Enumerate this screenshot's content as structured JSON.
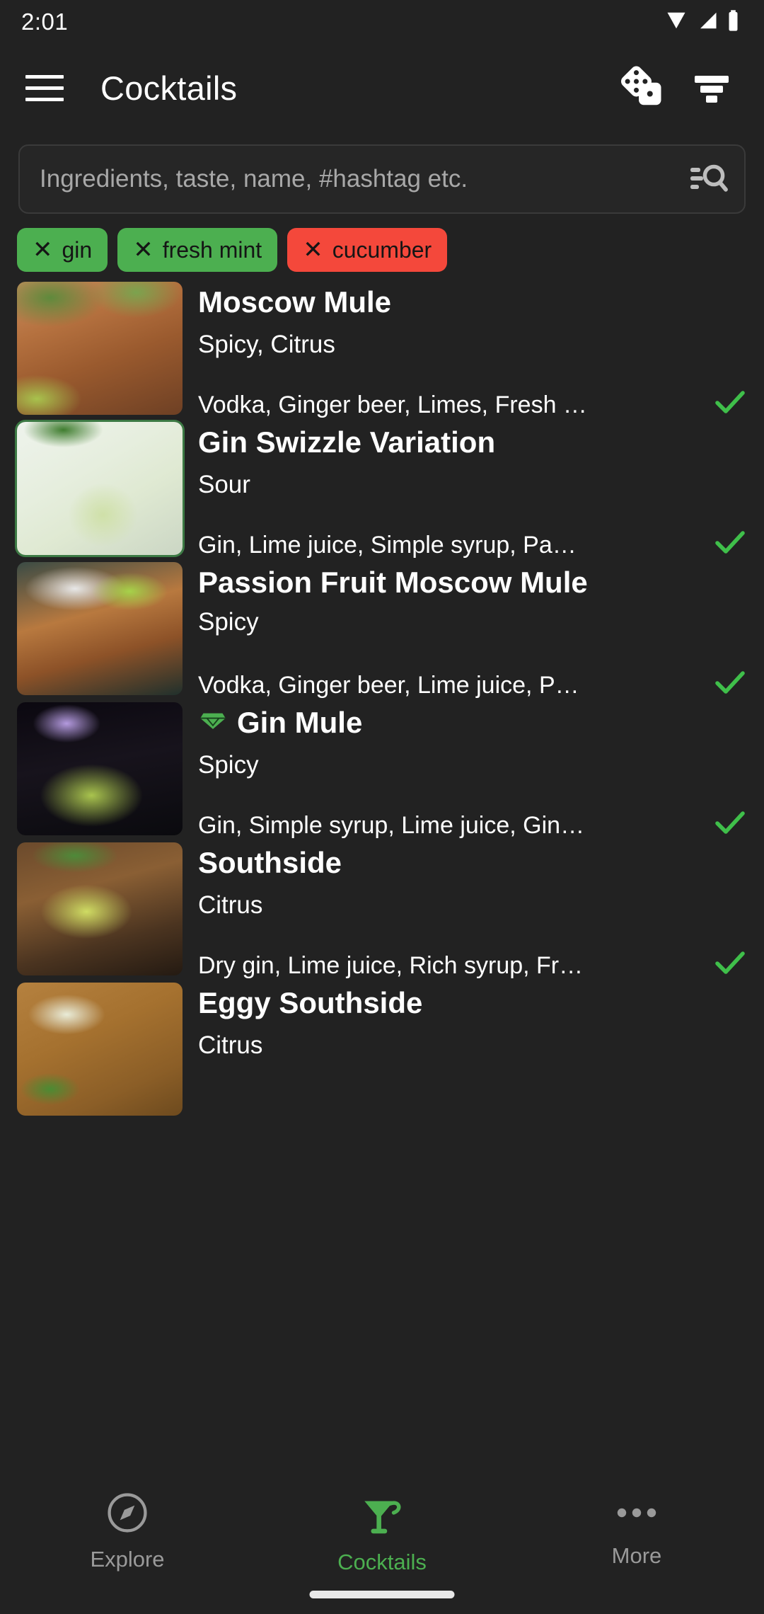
{
  "status_bar": {
    "time": "2:01",
    "icons": [
      "wifi-icon",
      "cellular-signal-icon",
      "battery-icon"
    ]
  },
  "app_bar": {
    "menu_icon": "hamburger-menu-icon",
    "title": "Cocktails",
    "random_icon": "dice-icon",
    "filter_icon": "filter-icon"
  },
  "search": {
    "placeholder": "Ingredients, taste, name, #hashtag etc.",
    "value": "",
    "icon": "search-with-lines-icon"
  },
  "filter_chips": [
    {
      "label": "gin",
      "color": "#4CAF50",
      "state": "include",
      "remove_icon": "close-x-icon"
    },
    {
      "label": "fresh mint",
      "color": "#4CAF50",
      "state": "include",
      "remove_icon": "close-x-icon"
    },
    {
      "label": "cucumber",
      "color": "#F4483B",
      "state": "exclude",
      "remove_icon": "close-x-icon"
    }
  ],
  "cocktails": [
    {
      "name": "Moscow Mule",
      "taste": "Spicy, Citrus",
      "ingredients": "Vodka, Ginger beer, Limes, Fresh …",
      "has_check": true,
      "premium": false,
      "highlight_ring": false
    },
    {
      "name": "Gin Swizzle Variation",
      "taste": "Sour",
      "ingredients": "Gin, Lime juice, Simple syrup, Pa…",
      "has_check": true,
      "premium": false,
      "highlight_ring": true
    },
    {
      "name": "Passion Fruit Moscow Mule",
      "taste": "Spicy",
      "ingredients": "Vodka, Ginger beer, Lime juice, P…",
      "has_check": true,
      "premium": false,
      "highlight_ring": false
    },
    {
      "name": "Gin Mule",
      "taste": "Spicy",
      "ingredients": "Gin, Simple syrup, Lime juice, Gin…",
      "has_check": true,
      "premium": true,
      "highlight_ring": false
    },
    {
      "name": "Southside",
      "taste": "Citrus",
      "ingredients": "Dry gin, Lime juice, Rich syrup, Fr…",
      "has_check": true,
      "premium": false,
      "highlight_ring": false
    },
    {
      "name": "Eggy Southside",
      "taste": "Citrus",
      "ingredients": "",
      "has_check": false,
      "premium": false,
      "highlight_ring": false
    }
  ],
  "bottom_nav": {
    "active": "Cocktails",
    "items": [
      {
        "label": "Explore",
        "icon": "compass-icon",
        "active": false
      },
      {
        "label": "Cocktails",
        "icon": "cocktail-glass-icon",
        "active": true
      },
      {
        "label": "More",
        "icon": "more-dots-icon",
        "active": false
      }
    ]
  },
  "colors": {
    "background": "#222222",
    "accent_green": "#4CAF50",
    "exclude_red": "#F4483B",
    "check_green": "#3FBF4A",
    "text_primary": "#FFFFFF",
    "text_muted": "#9A9A9A"
  }
}
